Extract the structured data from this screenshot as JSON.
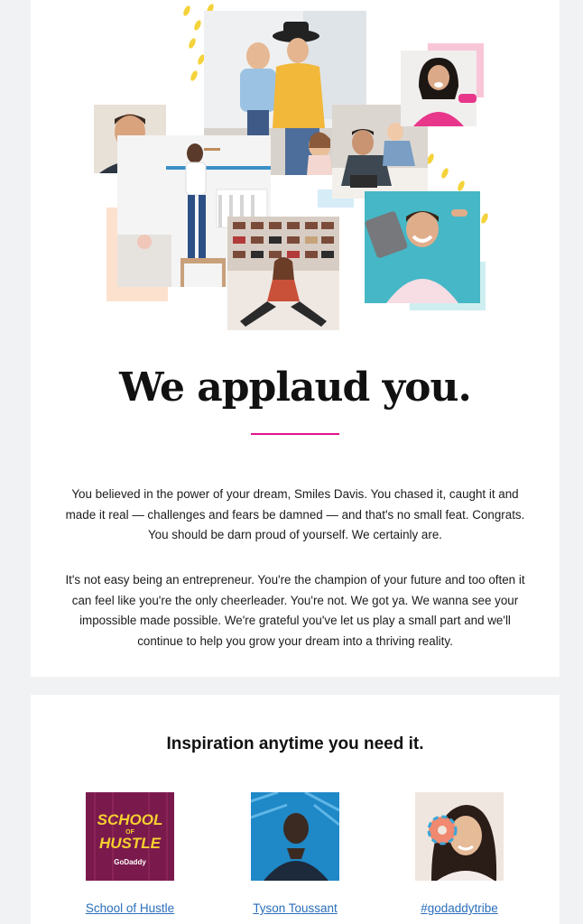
{
  "hero": {
    "headline": "We applaud you.",
    "paragraph_1": "You believed in the power of your dream, Smiles Davis. You chased it, caught it and made it real — challenges and fears be damned — and that's no small feat. Congrats. You should be darn proud of yourself. We certainly are.",
    "paragraph_2": "It's not easy being an entrepreneur. You're the champion of your future and too often it can feel like you're the only cheerleader. You're not. We got ya. We wanna see your impossible made possible. We're grateful you've let us play a small part and we'll continue to help you grow your dream into a thriving reality."
  },
  "inspiration": {
    "title": "Inspiration anytime you need it.",
    "tiles": [
      {
        "link": "School of Hustle",
        "art_line_1": "SCHOOL",
        "art_line_2": "OF",
        "art_line_3": "HUSTLE",
        "art_brand": "GoDaddy"
      },
      {
        "link": "Tyson Toussant"
      },
      {
        "link": "#godaddytribe"
      }
    ]
  },
  "colors": {
    "accent_pink": "#e0148a",
    "link_blue": "#2a6ebb",
    "yellow_dots": "#f4d23a"
  }
}
